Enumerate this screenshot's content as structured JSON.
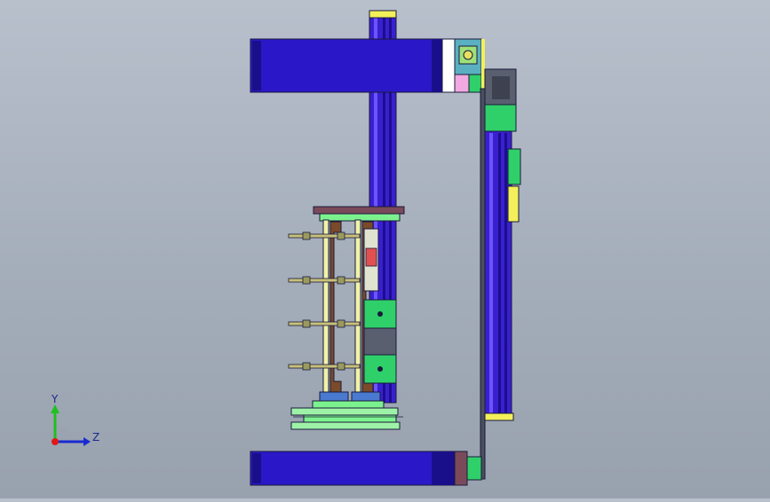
{
  "viewport": {
    "background_top": "#b8c0cc",
    "background_bottom": "#98a1ae"
  },
  "colors": {
    "rail_blue": "#3a1fd0",
    "rail_blue_dark": "#1a0f8a",
    "rail_blue_light": "#6a55ff",
    "green": "#2fd06a",
    "green_light": "#7cf28e",
    "yellow": "#f3f05a",
    "brown": "#7a4a2a",
    "grey": "#6e7380",
    "outline": "#1a1a3a"
  },
  "triad": {
    "y_label": "Y",
    "z_label": "Z",
    "icons": [
      "coordinate-triad-icon"
    ]
  }
}
